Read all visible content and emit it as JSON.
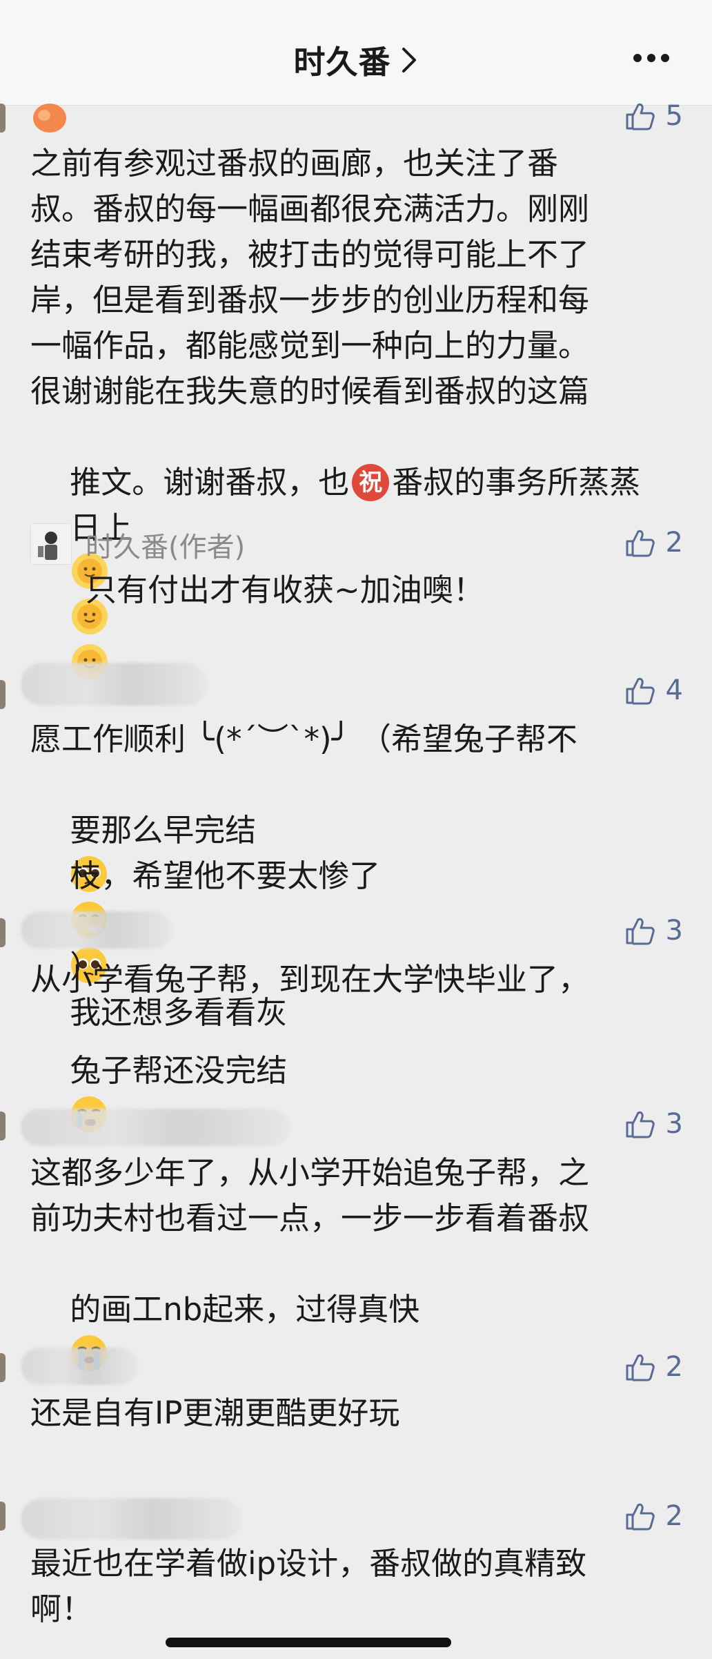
{
  "header": {
    "title": "时久番"
  },
  "comments": [
    {
      "likes": "5",
      "lines": [
        "之前有参观过番叔的画廊，也关注了番",
        "叔。番叔的每一幅画都很充满活力。刚刚",
        "结束考研的我，被打击的觉得可能上不了",
        "岸，但是看到番叔一步步的创业历程和每",
        "一幅作品，都能感觉到一种向上的力量。",
        "很谢谢能在我失意的时候看到番叔的这篇"
      ],
      "line7_a": "推文。谢谢番叔，也",
      "line7_badge": "祝",
      "line7_b": "番叔的事务所蒸蒸",
      "line8": "日上",
      "reply": {
        "name": "时久番(作者)",
        "likes": "2",
        "text": "只有付出才有收获~加油噢！"
      }
    },
    {
      "likes": "4",
      "line1": "愿工作顺利 ╰(*´︶`*)╯ （希望兔子帮不",
      "line2a": "要那么早完结",
      "line2b": "我还想多看看灰",
      "line3a": "枝，希望他不要太惨了",
      "line3b": "）"
    },
    {
      "likes": "3",
      "line1": "从小学看兔子帮，到现在大学快毕业了，",
      "line2": "兔子帮还没完结"
    },
    {
      "likes": "3",
      "line1": "这都多少年了，从小学开始追兔子帮，之",
      "line2": "前功夫村也看过一点，一步一步看着番叔",
      "line3": "的画工nb起来，过得真快"
    },
    {
      "likes": "2",
      "line1": "还是自有IP更潮更酷更好玩"
    },
    {
      "likes": "2",
      "line1": "最近也在学着做ip设计，番叔做的真精致",
      "line2": "啊！"
    }
  ],
  "colors": {
    "link": "#576b95",
    "background": "#ededed",
    "badge": "#e0483a"
  }
}
